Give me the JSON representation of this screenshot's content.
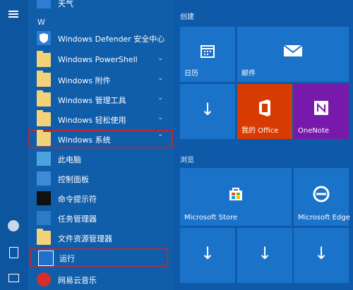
{
  "rail": {
    "menu_icon": "hamburger-icon",
    "user_icon": "user-avatar-icon",
    "documents_icon": "document-icon",
    "pictures_icon": "pictures-icon"
  },
  "apps": {
    "top_partial_label": "天气",
    "section_letter": "W",
    "items": [
      {
        "label": "Windows Defender 安全中心",
        "icon": "shield-icon",
        "chev": ""
      },
      {
        "label": "Windows PowerShell",
        "icon": "folder-icon",
        "chev": "⌄"
      },
      {
        "label": "Windows 附件",
        "icon": "folder-icon",
        "chev": "⌄"
      },
      {
        "label": "Windows 管理工具",
        "icon": "folder-icon",
        "chev": "⌄"
      },
      {
        "label": "Windows 轻松使用",
        "icon": "folder-icon",
        "chev": "⌄"
      },
      {
        "label": "Windows 系统",
        "icon": "folder-icon",
        "chev": "⌃"
      },
      {
        "label": "此电脑",
        "icon": "computer-icon",
        "chev": ""
      },
      {
        "label": "控制面板",
        "icon": "control-panel-icon",
        "chev": ""
      },
      {
        "label": "命令提示符",
        "icon": "cmd-icon",
        "chev": ""
      },
      {
        "label": "任务管理器",
        "icon": "task-manager-icon",
        "chev": ""
      },
      {
        "label": "文件资源管理器",
        "icon": "folder-explorer-icon",
        "chev": ""
      },
      {
        "label": "运行",
        "icon": "run-icon",
        "chev": ""
      },
      {
        "label": "网易云音乐",
        "icon": "music-icon",
        "chev": ""
      }
    ]
  },
  "tiles": {
    "group1_title": "创建",
    "group2_title": "浏览",
    "calendar": "日历",
    "mail": "邮件",
    "myoffice": "我的 Office",
    "onenote": "OneNote",
    "store": "Microsoft Store",
    "edge": "Microsoft Edge"
  },
  "colors": {
    "highlight": "#b52a3b",
    "office": "#d83b01",
    "onenote": "#7719aa",
    "tile": "#1b72c9"
  }
}
